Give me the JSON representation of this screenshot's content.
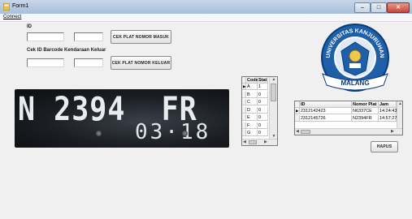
{
  "window": {
    "title": "Form1",
    "minimize": "–",
    "maximize": "□",
    "close": "✕"
  },
  "menu": {
    "connect": "Connect"
  },
  "form": {
    "id_label": "ID",
    "id_value_1": "",
    "id_value_2": "",
    "btn_masuk": "CEK PLAT NOMOR MASUK",
    "barcode_label": "Cek ID Barcode Kendaraan Keluar",
    "barcode_value_1": "",
    "barcode_value_2": "",
    "btn_keluar": "CEK PLAT NOMOR KELUAR",
    "btn_hapus": "HAPUS"
  },
  "plate": {
    "number": "N 2394  FR",
    "expiry": "03·18"
  },
  "logo": {
    "top_text": "UNIVERSITAS KANJURUHAN",
    "bottom_text": "MALANG"
  },
  "grid_codes": {
    "headers": [
      "Code",
      "Stat"
    ],
    "rows": [
      {
        "indicator": "▶",
        "code": "A",
        "stat": "1"
      },
      {
        "indicator": "",
        "code": "B",
        "stat": "0"
      },
      {
        "indicator": "",
        "code": "C",
        "stat": "0"
      },
      {
        "indicator": "",
        "code": "D",
        "stat": "0"
      },
      {
        "indicator": "",
        "code": "E",
        "stat": "0"
      },
      {
        "indicator": "",
        "code": "F",
        "stat": "0"
      },
      {
        "indicator": "",
        "code": "G",
        "stat": "0"
      }
    ]
  },
  "grid_log": {
    "headers": [
      "ID",
      "Nomor Plat",
      "Jam"
    ],
    "rows": [
      {
        "indicator": "▶",
        "id": "2312142423",
        "plate": "N6337CE",
        "time": "14:24:43"
      },
      {
        "indicator": "",
        "id": "2312145726",
        "plate": "N2394FR",
        "time": "14:57:27"
      }
    ]
  },
  "colors": {
    "titlebar": "#b9cbe2",
    "logo_blue": "#1e5fa8",
    "logo_dark": "#0b3a7a",
    "plate_bg": "#1a1d22"
  }
}
